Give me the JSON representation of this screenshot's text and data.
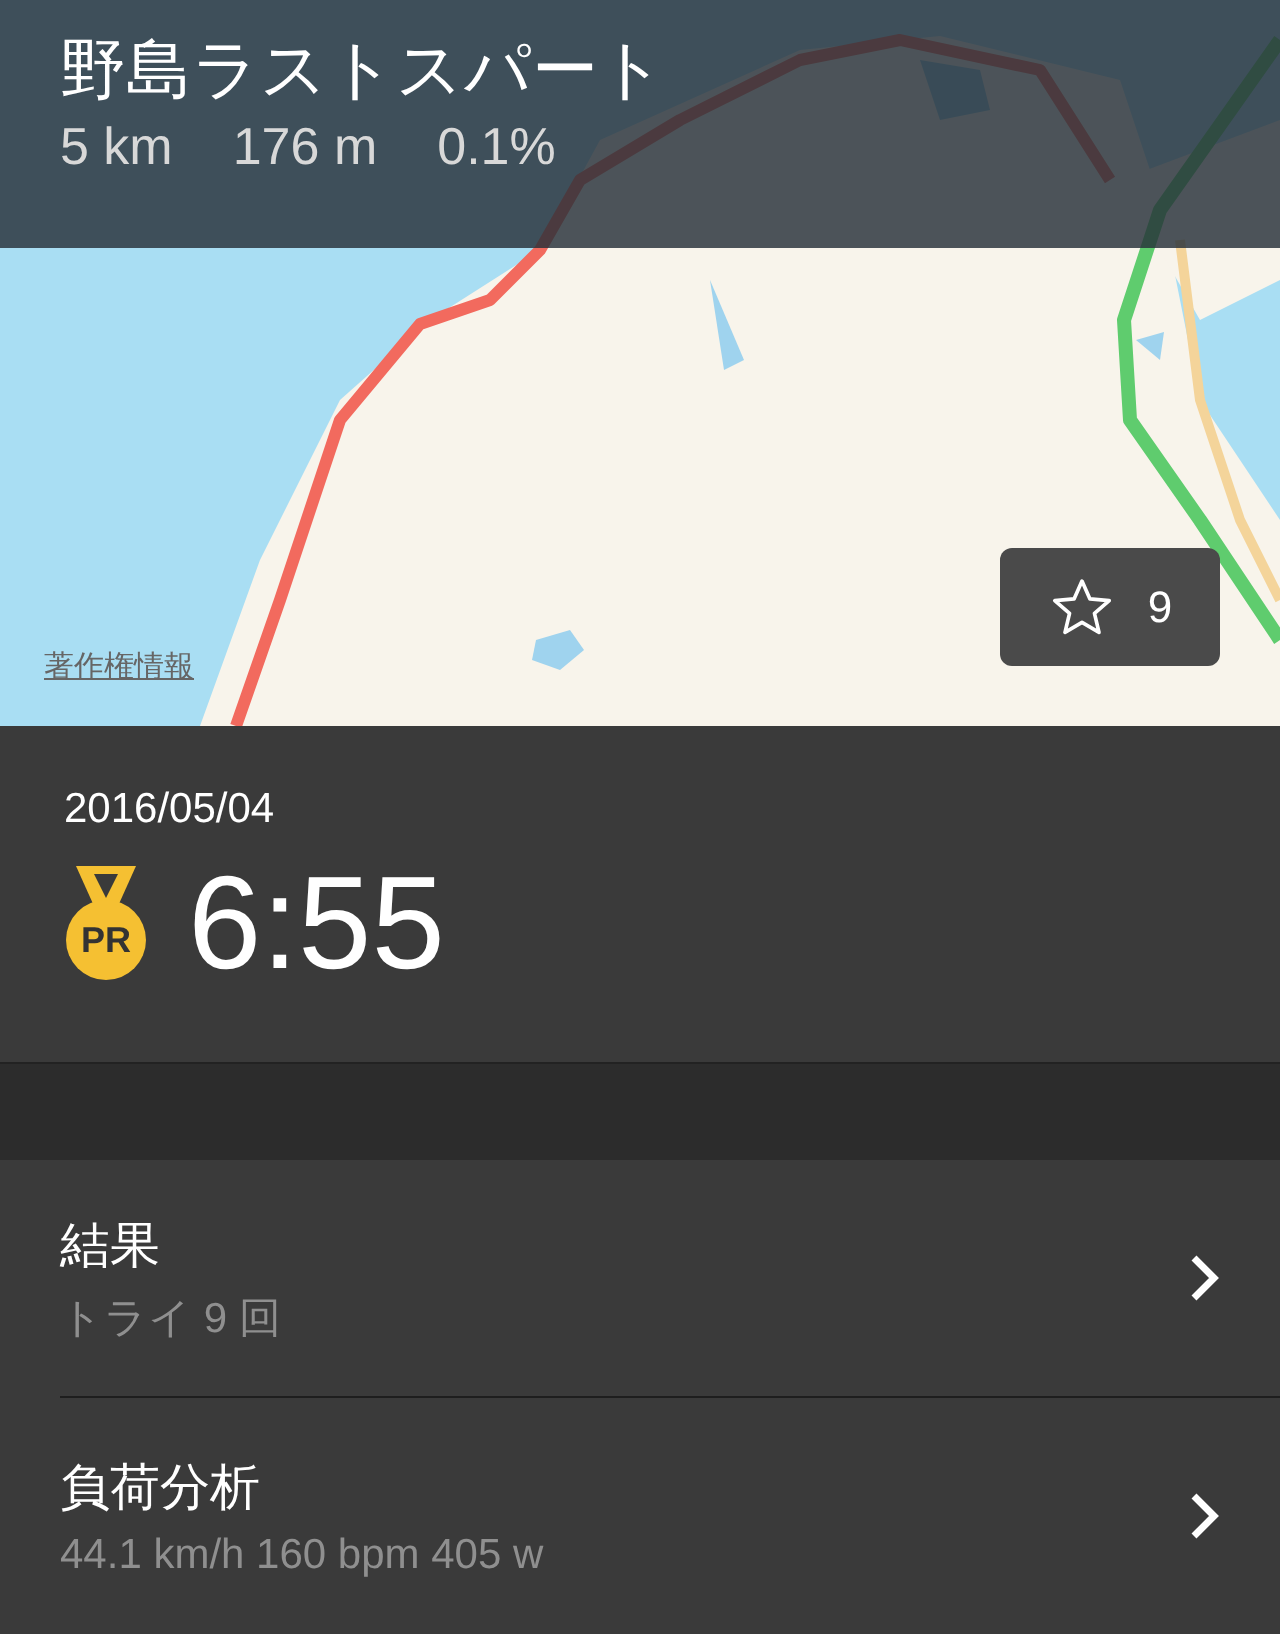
{
  "segment": {
    "title": "野島ラストスパート",
    "stats": [
      "5 km",
      "176 m",
      "0.1%"
    ]
  },
  "map": {
    "kind": "picture",
    "attribution": "著作権情報",
    "star_count": "9"
  },
  "effort": {
    "date": "2016/05/04",
    "badge": "PR",
    "time": "6:55"
  },
  "rows": [
    {
      "title": "結果",
      "subtitle": "トライ 9 回"
    },
    {
      "title": "負荷分析",
      "subtitle": "44.1 km/h 160 bpm 405 w"
    }
  ]
}
